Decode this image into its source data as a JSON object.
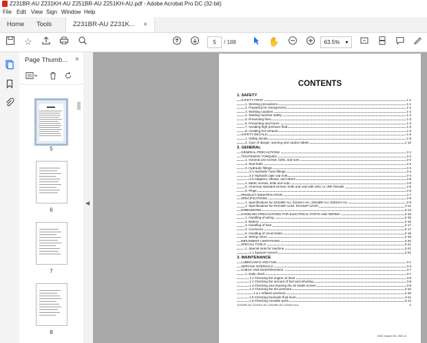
{
  "window": {
    "title": "Z231BR-AU Z231KH-AU Z251BR-AU Z251KH-AU.pdf - Adobe Acrobat Pro DC (32-bit)"
  },
  "menu": [
    "File",
    "Edit",
    "View",
    "Sign",
    "Window",
    "Help"
  ],
  "tabs": {
    "home": "Home",
    "tools": "Tools",
    "document": "Z231BR-AU Z231K...",
    "close": "×"
  },
  "toolbar": {
    "current_page": "5",
    "page_count": "/ 188",
    "zoom": "63.5%",
    "zoom_caret": "▾"
  },
  "thumbnails_panel": {
    "title": "Page Thumb...",
    "close": "×",
    "pages": [
      "5",
      "6",
      "7",
      "8"
    ],
    "selected_page": "5"
  },
  "document": {
    "heading": "CONTENTS",
    "toc": [
      {
        "text": "1. SAFETY",
        "page": "",
        "level": "sec"
      },
      {
        "text": "SAFETY FIRST",
        "page": "1-1",
        "level": "1"
      },
      {
        "text": "1. Working precautions",
        "page": "1-1",
        "level": "2"
      },
      {
        "text": "2. Preparing for emergencies",
        "page": "1-1",
        "level": "2"
      },
      {
        "text": "3. Working cautions",
        "page": "1-2",
        "level": "2"
      },
      {
        "text": "4. Starting machine safely",
        "page": "1-2",
        "level": "2"
      },
      {
        "text": "5. Preventing fires",
        "page": "1-3",
        "level": "2"
      },
      {
        "text": "6. Preventing acid burns",
        "page": "1-3",
        "level": "2"
      },
      {
        "text": "7. Avoiding high pressure fluid",
        "page": "1-3",
        "level": "2"
      },
      {
        "text": "8. Avoiding hot exhaust",
        "page": "1-4",
        "level": "2"
      },
      {
        "text": "SAFETY DECALS",
        "page": "1-5",
        "level": "1"
      },
      {
        "text": "1. Safety decals",
        "page": "1-5",
        "level": "2"
      },
      {
        "text": "2. Care of danger, warning and caution labels",
        "page": "1-10",
        "level": "2"
      },
      {
        "text": "2. GENERAL",
        "page": "",
        "level": "sec"
      },
      {
        "text": "GENERAL PRECAUTIONS",
        "page": "2-1",
        "level": "1"
      },
      {
        "text": "TIGHTENING TORQUES",
        "page": "2-2",
        "level": "1"
      },
      {
        "text": "1. General use screws, bolts, and nuts",
        "page": "2-2",
        "level": "2"
      },
      {
        "text": "2. Stud bolts",
        "page": "2-3",
        "level": "2"
      },
      {
        "text": "3. Hydraulic fittings",
        "page": "2-4",
        "level": "2"
      },
      {
        "text": "3.1 Hydraulic hose fittings",
        "page": "2-4",
        "level": "3"
      },
      {
        "text": "3.2 Hydraulic pipe cap nuts",
        "page": "2-4",
        "level": "3"
      },
      {
        "text": "3.3 Adapters, elbows, and others",
        "page": "2-5",
        "level": "3"
      },
      {
        "text": "4. Metric screws, bolts and nuts",
        "page": "2-6",
        "level": "2"
      },
      {
        "text": "5. American standard screws, bolts and nuts with UNC or UNF threads",
        "page": "2-6",
        "level": "2"
      },
      {
        "text": "6. Plugs",
        "page": "2-6",
        "level": "2"
      },
      {
        "text": "PRODUCT IDENTIFICATION",
        "page": "2-7",
        "level": "1"
      },
      {
        "text": "SPECIFICATIONS",
        "page": "2-9",
        "level": "1"
      },
      {
        "text": "1. Specifications for Z231BR-AU, Z231KH-AU, Z251BR-AU, Z251KH-AU",
        "page": "2-9",
        "level": "2"
      },
      {
        "text": "2. Specifications for RCK48P-124Z, RCK54P-127ZA",
        "page": "2-11",
        "level": "2"
      },
      {
        "text": "DIMENSIONS",
        "page": "2-13",
        "level": "1"
      },
      {
        "text": "HANDLING PRECAUTIONS FOR ELECTRICAL PARTS AND WIRING",
        "page": "2-15",
        "level": "1"
      },
      {
        "text": "1. Handling of wiring",
        "page": "2-15",
        "level": "2"
      },
      {
        "text": "2. Battery",
        "page": "2-16",
        "level": "2"
      },
      {
        "text": "3. Handling of fuse",
        "page": "2-17",
        "level": "2"
      },
      {
        "text": "4. Connector",
        "page": "2-17",
        "level": "2"
      },
      {
        "text": "5. Handling of circuit tester",
        "page": "2-18",
        "level": "2"
      },
      {
        "text": "6. Wiring colors",
        "page": "2-19",
        "level": "2"
      },
      {
        "text": "IMPLEMENT LIMITATIONS",
        "page": "2-20",
        "level": "1"
      },
      {
        "text": "SPECIAL TOOLS",
        "page": "2-21",
        "level": "1"
      },
      {
        "text": "1. Special tools for machine",
        "page": "2-21",
        "level": "2"
      },
      {
        "text": "1.1 Spanner wrench",
        "page": "2-21",
        "level": "3"
      },
      {
        "text": "3. MAINTENANCE",
        "page": "",
        "level": "sec"
      },
      {
        "text": "LUBRICANTS AND FUEL",
        "page": "3-1",
        "level": "1"
      },
      {
        "text": "SERVICE INTERVALS",
        "page": "3-3",
        "level": "1"
      },
      {
        "text": "CHECK AND MAINTENANCE",
        "page": "3-7",
        "level": "1"
      },
      {
        "text": "1. Daily check",
        "page": "3-7",
        "level": "2"
      },
      {
        "text": "1.1 Checking the engine oil level",
        "page": "3-8",
        "level": "3"
      },
      {
        "text": "1.2 Checking the amount of fuel and refueling",
        "page": "3-8",
        "level": "3"
      },
      {
        "text": "1.3 Checking and cleaning the air intake screen",
        "page": "3-9",
        "level": "3"
      },
      {
        "text": "1.4 Checking the tire pressure",
        "page": "3-10",
        "level": "3"
      },
      {
        "text": "1.4.1 Inflation pressure",
        "page": "3-10",
        "level": "4"
      },
      {
        "text": "1.5 Checking transaxle fluid level",
        "page": "3-11",
        "level": "3"
      },
      {
        "text": "1.6 Checking movable parts",
        "page": "3-12",
        "level": "3"
      }
    ],
    "footer_left": "Z231BR-AU Z231KH-AU Z251BR-AU Z251KH-AU",
    "footer_right": "iii",
    "footer_date": "KiSC issued 05, 2021 A"
  }
}
